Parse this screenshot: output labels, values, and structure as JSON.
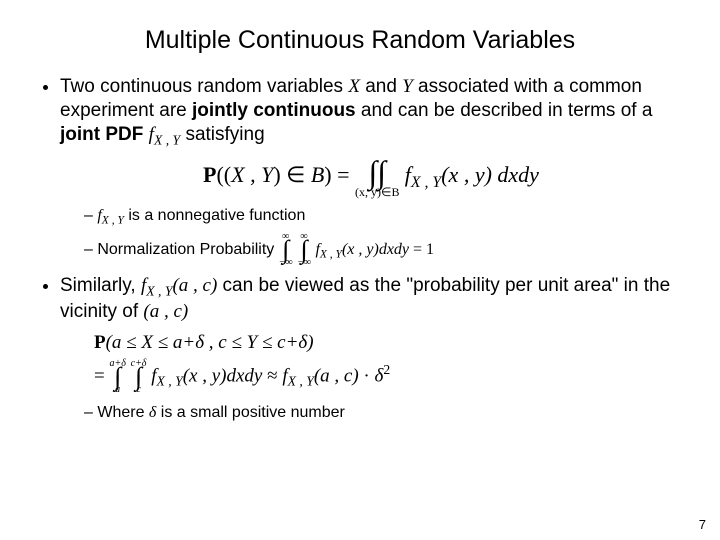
{
  "title": "Multiple Continuous Random Variables",
  "bullet1": {
    "t1": "Two continuous random variables ",
    "sym_x": "X",
    "t2": " and ",
    "sym_y": "Y",
    "t3": " associated with a common experiment are ",
    "bold": "jointly continuous",
    "t4": " and can be described in terms of a ",
    "bold2": "joint PDF",
    "t5": " ",
    "fxy": "f",
    "fxy_sub": "X , Y",
    "t6": "  satisfying"
  },
  "eq1": {
    "P": "P",
    "lparen2": "((",
    "XY": "X , Y",
    "rparen": ")",
    "in": " ∈ ",
    "B": "B",
    "rparen2": ")",
    "eq": " = ",
    "dint_region": "(x, y)∈B",
    "f": "f",
    "f_sub": "X , Y",
    "args": "(x , y)",
    "dxdy": " dxdy"
  },
  "sub1": {
    "f": "f",
    "f_sub": "X , Y",
    "text": " is a nonnegative function"
  },
  "sub2": {
    "label": "Normalization Probability  ",
    "inf": "∞",
    "ninf": "−∞",
    "f": "f",
    "f_sub": "X , Y",
    "args": "(x , y)",
    "dxdy": "dxdy",
    "eq1": " = 1"
  },
  "bullet2": {
    "t1": "Similarly, ",
    "f": "f",
    "f_sub": "X , Y",
    "args": "(a , c)",
    "t2": " can be viewed as the \"probability per unit area\" in the vicinity of ",
    "ac": "(a , c)"
  },
  "eq2": {
    "P": "P",
    "prob_args": "(a ≤ X ≤ a+δ ,  c ≤ Y ≤ c+δ)",
    "eq": "=",
    "lim1_top": "a+δ",
    "lim1_bot": "a",
    "lim2_top": "c+δ",
    "lim2_bot": "c",
    "f1": "f",
    "f1_sub": "X , Y",
    "args1": "(x , y)",
    "dxdy": "dxdy",
    "approx": " ≈ ",
    "f2": "f",
    "f2_sub": "X , Y",
    "args2": "(a , c)",
    "dot": " · ",
    "delta": "δ",
    "two": "2"
  },
  "sub3": {
    "t1": "Where ",
    "delta": "δ",
    "t2": " is a small positive number"
  },
  "pagenum": "7"
}
